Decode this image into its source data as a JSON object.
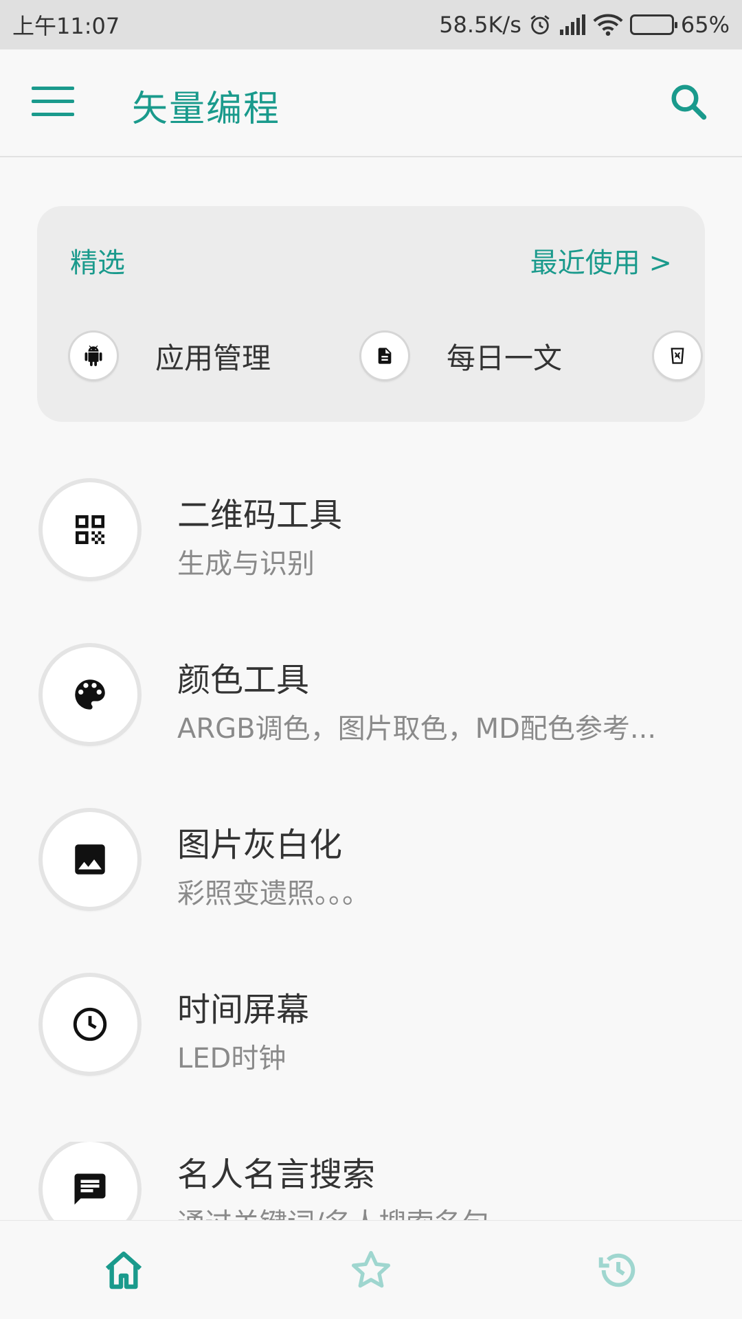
{
  "status": {
    "time": "上午11:07",
    "speed": "58.5K/s",
    "battery": "65%",
    "battery_level": 0.65
  },
  "appbar": {
    "title": "矢量编程"
  },
  "featured": {
    "title": "精选",
    "recent_link": "最近使用 >",
    "chips": [
      {
        "label": "应用管理",
        "icon": "android-icon"
      },
      {
        "label": "每日一文",
        "icon": "document-icon"
      },
      {
        "label": "",
        "icon": "trash-icon"
      }
    ]
  },
  "items": [
    {
      "title": "二维码工具",
      "subtitle": "生成与识别",
      "icon": "qr-code-icon"
    },
    {
      "title": "颜色工具",
      "subtitle": "ARGB调色，图片取色，MD配色参考...",
      "icon": "palette-icon"
    },
    {
      "title": "图片灰白化",
      "subtitle": "彩照变遗照。。。",
      "icon": "image-icon"
    },
    {
      "title": "时间屏幕",
      "subtitle": "LED时钟",
      "icon": "clock-icon"
    },
    {
      "title": "名人名言搜索",
      "subtitle": "通过关键词/名人搜索名句",
      "icon": "quote-icon"
    }
  ],
  "colors": {
    "accent": "#1a9a8c",
    "accent_light": "#9fd6cf"
  },
  "bottomnav": [
    "home-icon",
    "star-icon",
    "history-icon"
  ]
}
